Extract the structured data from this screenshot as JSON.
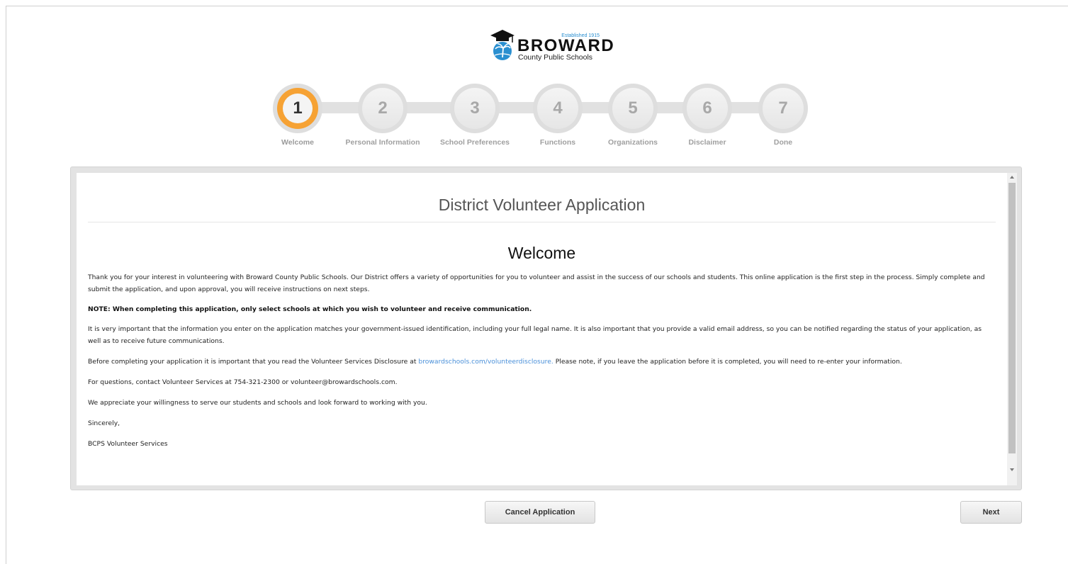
{
  "logo": {
    "established": "Established 1915",
    "name": "BROWARD",
    "subtitle": "County Public Schools",
    "icon": "graduation-cap-palm-logo"
  },
  "stepper": {
    "active_color": "#f6a234",
    "steps": [
      {
        "number": "1",
        "label": "Welcome",
        "active": true
      },
      {
        "number": "2",
        "label": "Personal Information",
        "active": false
      },
      {
        "number": "3",
        "label": "School Preferences",
        "active": false
      },
      {
        "number": "4",
        "label": "Functions",
        "active": false
      },
      {
        "number": "5",
        "label": "Organizations",
        "active": false
      },
      {
        "number": "6",
        "label": "Disclaimer",
        "active": false
      },
      {
        "number": "7",
        "label": "Done",
        "active": false
      }
    ]
  },
  "content": {
    "title": "District Volunteer Application",
    "heading": "Welcome",
    "p1": "Thank you for your interest in volunteering with Broward County Public Schools. Our District offers a variety of opportunities for you to volunteer and assist in the success of our schools and students. This online application is the first step in the process. Simply complete and submit the application, and upon approval, you will receive instructions on next steps.",
    "note": "NOTE: When completing this application, only select schools at which you wish to volunteer and receive communication.",
    "p2": "It is very important that the information you enter on the application matches your government-issued identification, including your full legal name. It is also important that you provide a valid email address, so you can be notified regarding the status of your application, as well as to receive future communications.",
    "p3_before": "Before completing your application it is important that you read the Volunteer Services Disclosure at ",
    "p3_link": "browardschools.com/volunteerdisclosure.",
    "p3_after": " Please note, if you leave the application before it is completed, you will need to re-enter your information.",
    "p4": "For questions, contact Volunteer Services at 754-321-2300 or volunteer@browardschools.com.",
    "p5": "We appreciate your willingness to serve our students and schools and look forward to working with you.",
    "p6": "Sincerely,",
    "p7": "BCPS Volunteer Services",
    "link_color": "#4a90d9"
  },
  "buttons": {
    "cancel": "Cancel Application",
    "next": "Next"
  }
}
